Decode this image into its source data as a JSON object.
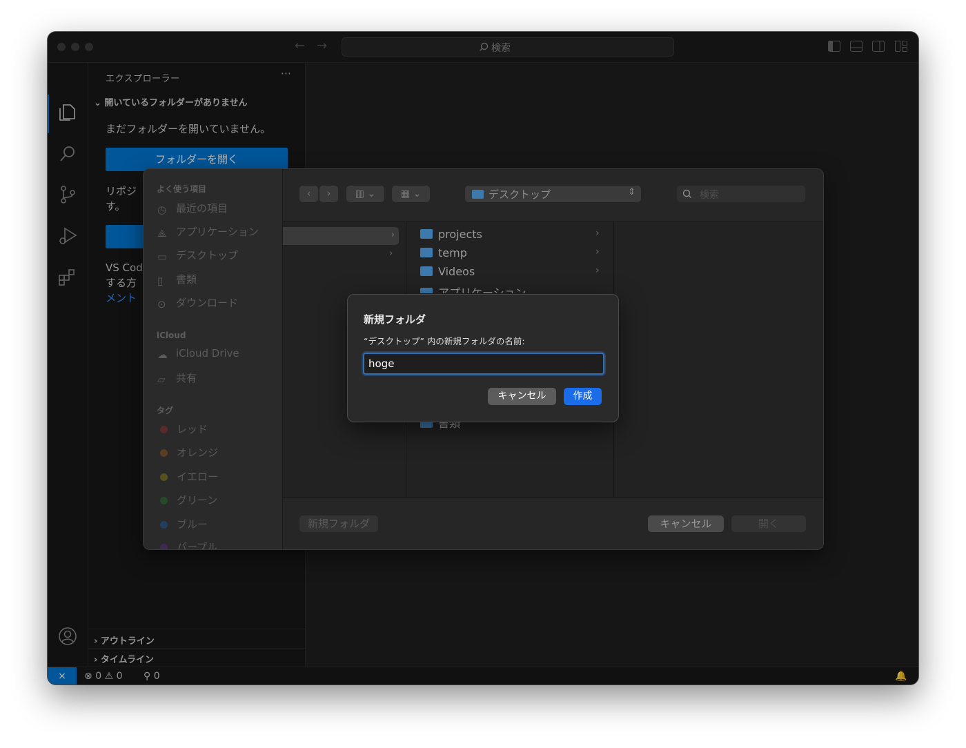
{
  "titlebar": {
    "search_label": "検索"
  },
  "sidebar": {
    "title": "エクスプローラー",
    "more": "···",
    "section_no_folder": "開いているフォルダーがありません",
    "msg_no_folder": "まだフォルダーを開いていません。",
    "open_folder_button": "フォルダーを開く",
    "repo_text_1": "リポジ",
    "repo_text_2": "す。",
    "vscode_text_1": "VS Cod",
    "vscode_text_2": "する方",
    "docs_link": "メント",
    "outline": "アウトライン",
    "timeline": "タイムライン"
  },
  "statusbar": {
    "errors": "0",
    "warnings": "0",
    "ports": "0"
  },
  "open_panel": {
    "favorites_header": "よく使う項目",
    "favorites": [
      "最近の項目",
      "アプリケーション",
      "デスクトップ",
      "書類",
      "ダウンロード"
    ],
    "icloud_header": "iCloud",
    "icloud": [
      "iCloud Drive",
      "共有"
    ],
    "tags_header": "タグ",
    "tags": [
      {
        "label": "レッド",
        "color": "#5a2a2a"
      },
      {
        "label": "オレンジ",
        "color": "#5a3e22"
      },
      {
        "label": "イエロー",
        "color": "#57501f"
      },
      {
        "label": "グリーン",
        "color": "#244a2a"
      },
      {
        "label": "ブルー",
        "color": "#213e5e"
      },
      {
        "label": "パープル",
        "color": "#3e2a52"
      }
    ],
    "location": "デスクトップ",
    "search_placeholder": "検索",
    "files": [
      "projects",
      "temp",
      "Videos",
      "アプリケーション",
      "書類"
    ],
    "new_folder_button": "新規フォルダ",
    "cancel_button": "キャンセル",
    "open_button": "開く"
  },
  "dialog": {
    "title": "新規フォルダ",
    "message": "“デスクトップ” 内の新規フォルダの名前:",
    "input_value": "hoge",
    "cancel": "キャンセル",
    "create": "作成"
  },
  "colors": {
    "accent": "#0078d4",
    "dialog_primary": "#1a6ce8",
    "folder": "#3d79ad"
  }
}
